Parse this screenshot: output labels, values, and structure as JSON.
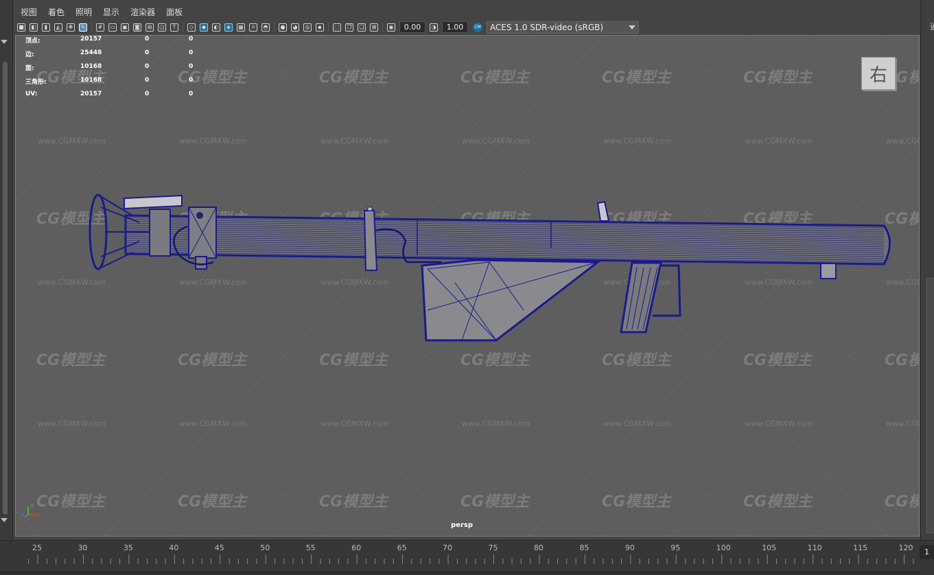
{
  "menu": [
    "视图",
    "着色",
    "照明",
    "显示",
    "渲染器",
    "面板"
  ],
  "toolbar": {
    "exposure_value": "0.00",
    "gamma_value": "1.00",
    "color_space": "ACES 1.0 SDR-video (sRGB)",
    "color_mgmt_badge": "CM"
  },
  "hud": {
    "rows": [
      {
        "label": "顶点:",
        "v1": "20157",
        "v2": "0",
        "v3": "0"
      },
      {
        "label": "边:",
        "v1": "25448",
        "v2": "0",
        "v3": "0"
      },
      {
        "label": "面:",
        "v1": "10168",
        "v2": "0",
        "v3": "0"
      },
      {
        "label": "三角形:",
        "v1": "10168",
        "v2": "0",
        "v3": "0"
      },
      {
        "label": "UV:",
        "v1": "20157",
        "v2": "0",
        "v3": "0"
      }
    ]
  },
  "viewcube_label": "右",
  "camera_label": "persp",
  "axis": {
    "x": "x",
    "y": "y",
    "z": "z"
  },
  "watermark": {
    "logo": "CG模型主",
    "url": "www.CGMXW.com"
  },
  "right_strip_text": "通",
  "timeline": {
    "ticks": [
      "25",
      "30",
      "35",
      "40",
      "45",
      "50",
      "55",
      "60",
      "65",
      "70",
      "75",
      "80",
      "85",
      "90",
      "95",
      "100",
      "105",
      "110",
      "115",
      "120"
    ],
    "current_frame": "1"
  },
  "colors": {
    "viewport_bg": "#5e5e5e",
    "wireframe": "#1a1a8c",
    "mesh_fill": "#6f6f74",
    "ui_bg": "#444444"
  }
}
